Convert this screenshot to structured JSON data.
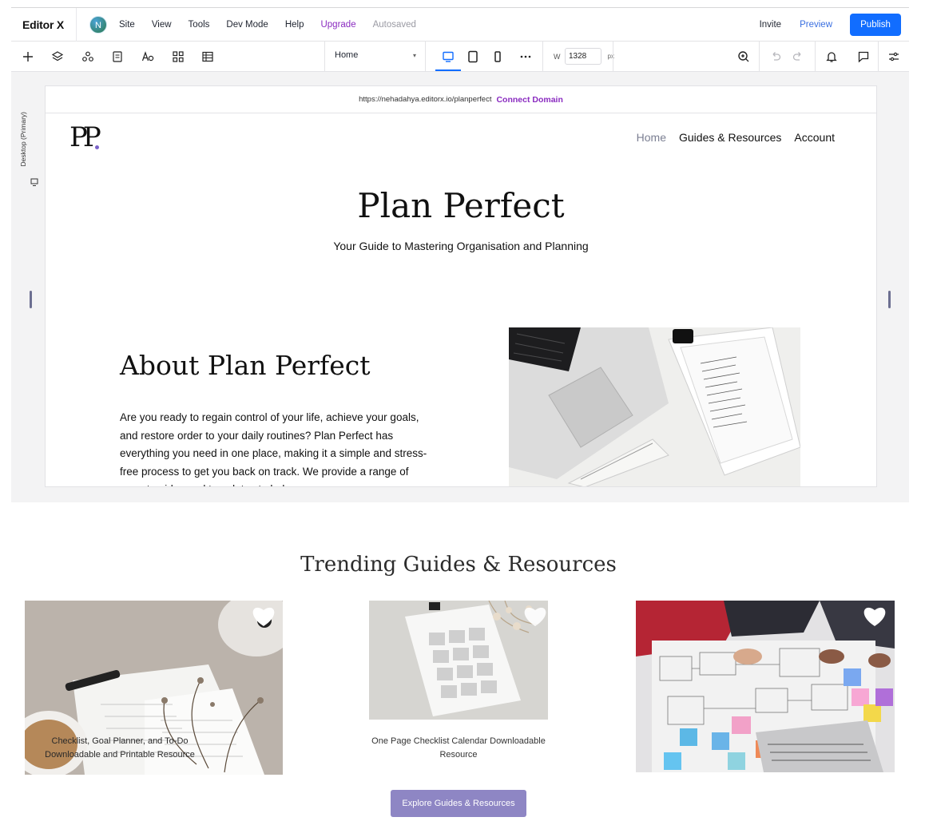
{
  "topbar": {
    "brand": "Editor X",
    "avatar_initial": "N",
    "menu": [
      "Site",
      "View",
      "Tools",
      "Dev Mode",
      "Help"
    ],
    "upgrade": "Upgrade",
    "autosaved": "Autosaved",
    "invite": "Invite",
    "preview": "Preview",
    "publish": "Publish",
    "accent": "#116dff",
    "upgrade_color": "#8a2bc0"
  },
  "toolbar": {
    "left_icons": [
      "add-icon",
      "layers-icon",
      "components-icon",
      "pages-icon",
      "design-icon",
      "apps-icon",
      "cms-icon"
    ],
    "page": "Home",
    "devices": [
      "desktop-icon",
      "tablet-icon",
      "mobile-icon",
      "more-icon"
    ],
    "width_label": "W",
    "width_value": "1328",
    "width_unit": "px",
    "right_icons": [
      "zoom-icon",
      "undo-icon",
      "redo-icon",
      "notifications-icon",
      "comments-icon",
      "settings-sliders-icon"
    ]
  },
  "canvas": {
    "side_label": "Desktop (Primary)",
    "url": "https://nehadahya.editorx.io/planperfect",
    "connect": "Connect Domain"
  },
  "site": {
    "logo": "PP",
    "nav": [
      "Home",
      "Guides & Resources",
      "Account"
    ],
    "hero_title": "Plan Perfect",
    "hero_subtitle": "Your Guide to Mastering Organisation and Planning",
    "about_title": "About Plan Perfect",
    "about_body": "Are you ready to regain control of your life, achieve your goals, and restore order to your daily routines? Plan Perfect has everything you need in one place, making it a simple and stress-free process to get you back on track. We provide a range of expert guides and templates to help..."
  },
  "trending": {
    "title": "Trending Guides & Resources",
    "card1_caption": "Checklist, Goal Planner, and To-Do Downloadable and Printable Resource",
    "card2_caption": "One Page Checklist Calendar Downloadable Resource",
    "button": "Explore Guides & Resources",
    "button_color": "#8e86c4"
  }
}
